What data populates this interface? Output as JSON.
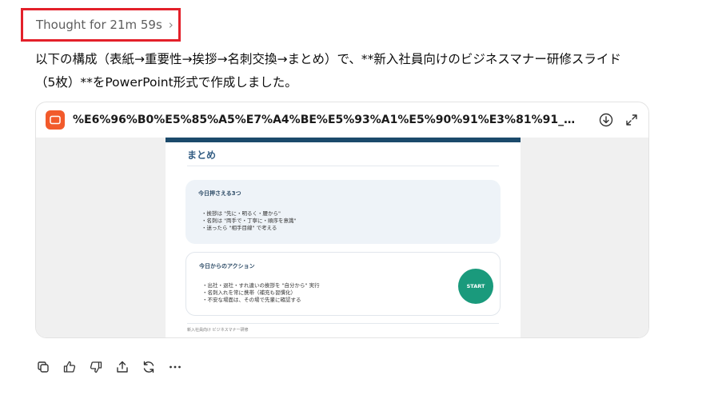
{
  "thought": {
    "label": "Thought for 21m 59s",
    "chevron": "›"
  },
  "message": {
    "line1": "以下の構成（表紙→重要性→挨拶→名刺交換→まとめ）で、**新入社員向けのビジネスマナー研修スライド",
    "line2": "（5枚）**をPowerPoint形式で作成しました。"
  },
  "file_card": {
    "filename": "%E6%96%B0%E5%85%A5%E7%A4%BE%E5%93%A1%E5%90%91%E3%81%91_%E3%83...",
    "icon": "presentation-file-icon",
    "accent": "#f25a2b",
    "slide": {
      "title": "まとめ",
      "box1": {
        "title": "今日押さえる3つ",
        "items": [
          "・挨拶は \"先に・明るく・腰から\"",
          "・名刺は \"両手で・丁寧に・順序を意識\"",
          "・迷ったら \"相手目線\" で考える"
        ]
      },
      "box2": {
        "title": "今日からのアクション",
        "items": [
          "・出社・退社・すれ違いの挨拶を \"自分から\" 実行",
          "・名刺入れを常に携帯（補充も習慣化）",
          "・不安な場面は、その場で先輩に確認する"
        ],
        "button": "START",
        "button_color": "#1a9a7c"
      },
      "footer": "新入社員向け ビジネスマナー研修",
      "bar_color": "#1b4a6b"
    }
  },
  "actions": [
    "copy-icon",
    "thumbs-up-icon",
    "thumbs-down-icon",
    "share-icon",
    "regenerate-icon",
    "more-icon"
  ]
}
